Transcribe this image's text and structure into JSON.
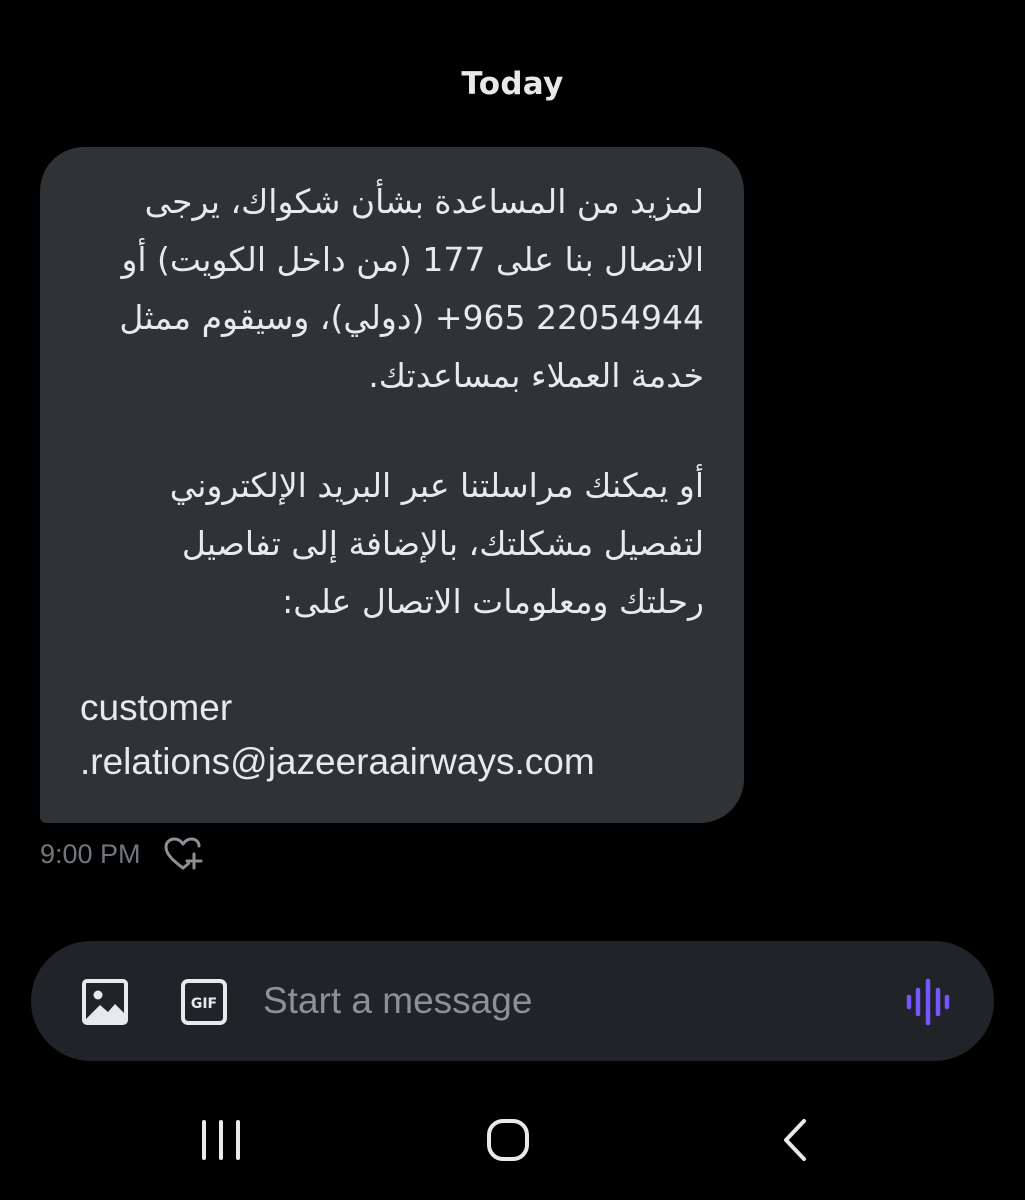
{
  "conversation": {
    "date_label": "Today",
    "message": {
      "paragraph1": [
        "لمزيد من المساعدة بشأن شكواك، يرجى",
        "الاتصال بنا على 177 (من داخل الكويت) أو",
        "22054944 965+ (دولي)، وسيقوم ممثل",
        "خدمة العملاء بمساعدتك."
      ],
      "paragraph2": [
        "أو يمكنك مراسلتنا عبر البريد الإلكتروني",
        "لتفصيل مشكلتك، بالإضافة إلى تفاصيل",
        "رحلتك ومعلومات الاتصال على:"
      ],
      "email_lines": [
        "customer",
        ".relations@jazeeraairways.com"
      ],
      "time": "9:00 PM"
    }
  },
  "composer": {
    "placeholder": "Start a message",
    "image_icon": "image-icon",
    "gif_icon": "gif-icon",
    "voice_icon": "voice-waveform-icon",
    "accent_color": "#7856ff"
  },
  "navigation": {
    "recent_icon": "recent-apps-icon",
    "home_icon": "home-icon",
    "back_icon": "back-icon"
  }
}
